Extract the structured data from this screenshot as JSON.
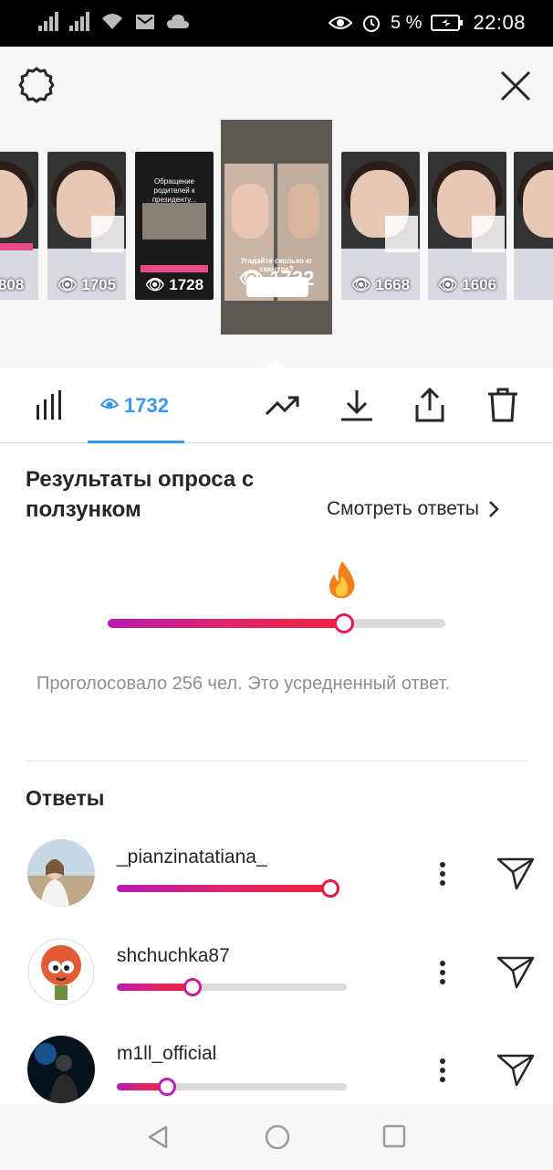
{
  "status_bar": {
    "battery_percent": "5 %",
    "time": "22:08"
  },
  "stories": [
    {
      "views": "808"
    },
    {
      "views": "1705"
    },
    {
      "views": "1728",
      "title": "Обращение родителей к президенту..."
    },
    {
      "views": "1732",
      "question": "Угадайте сколько кг скинула?",
      "selected": true
    },
    {
      "views": "1668"
    },
    {
      "views": "1606"
    },
    {
      "views": ""
    }
  ],
  "tabs": {
    "views_count": "1732"
  },
  "poll": {
    "title": "Результаты опроса с ползунком",
    "see_answers": "Смотреть ответы",
    "emoji": "🔥",
    "average": 0.7,
    "votes_text": "Проголосовало 256 чел. Это усредненный ответ."
  },
  "answers": {
    "title": "Ответы",
    "items": [
      {
        "username": "_pianzinatatiana_",
        "value": 0.96
      },
      {
        "username": "shchuchka87",
        "value": 0.33
      },
      {
        "username": "m1ll_official",
        "value": 0.22
      }
    ]
  }
}
